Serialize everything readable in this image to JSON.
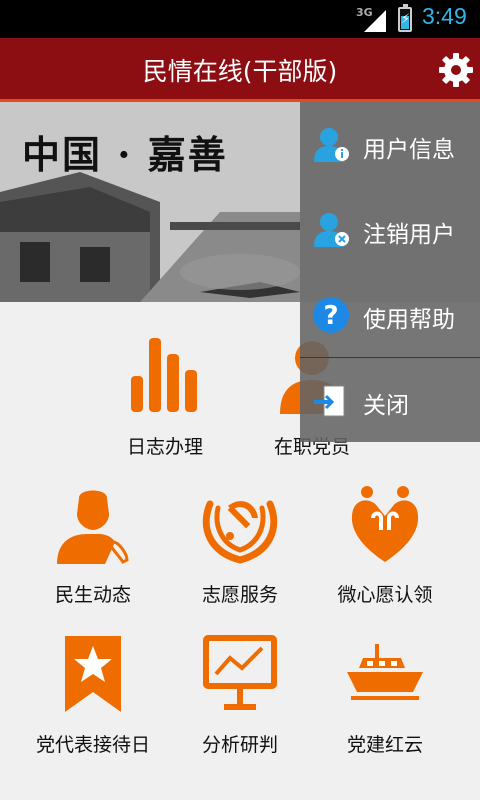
{
  "status_bar": {
    "network": "3G",
    "time": "3:49"
  },
  "header": {
    "title": "民情在线(干部版)"
  },
  "banner": {
    "calligraphy": "中国 · 嘉善"
  },
  "grid": {
    "items": [
      {
        "label": "日志办理",
        "icon": "bar-chart-icon"
      },
      {
        "label": "在职党员",
        "icon": "party-member-icon"
      },
      {
        "label": "民生动态",
        "icon": "person-phone-icon"
      },
      {
        "label": "志愿服务",
        "icon": "party-emblem-icon"
      },
      {
        "label": "微心愿认领",
        "icon": "heart-people-icon"
      },
      {
        "label": "党代表接待日",
        "icon": "star-bookmark-icon"
      },
      {
        "label": "分析研判",
        "icon": "line-chart-board-icon"
      },
      {
        "label": "党建红云",
        "icon": "red-boat-icon"
      }
    ]
  },
  "menu": {
    "items": [
      {
        "label": "用户信息",
        "icon": "user-info-icon"
      },
      {
        "label": "注销用户",
        "icon": "user-logout-icon"
      },
      {
        "label": "使用帮助",
        "icon": "help-icon"
      },
      {
        "label": "关闭",
        "icon": "exit-icon"
      }
    ]
  },
  "colors": {
    "title_bar": "#8d0e12",
    "accent": "#e64a19",
    "icon_orange": "#ef6c00",
    "clock": "#33b5e5"
  }
}
